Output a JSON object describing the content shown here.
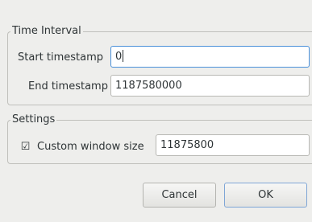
{
  "time_interval": {
    "legend": "Time Interval",
    "start_label": "Start timestamp",
    "start_value": "0",
    "end_label": "End timestamp",
    "end_value": "1187580000"
  },
  "settings": {
    "legend": "Settings",
    "checkbox_checked": true,
    "checkbox_glyph": "☑",
    "custom_window_label": "Custom window size",
    "custom_window_value": "11875800"
  },
  "buttons": {
    "cancel": "Cancel",
    "ok": "OK"
  },
  "colors": {
    "window_bg": "#eeeeec",
    "focus": "#4a90d9"
  }
}
